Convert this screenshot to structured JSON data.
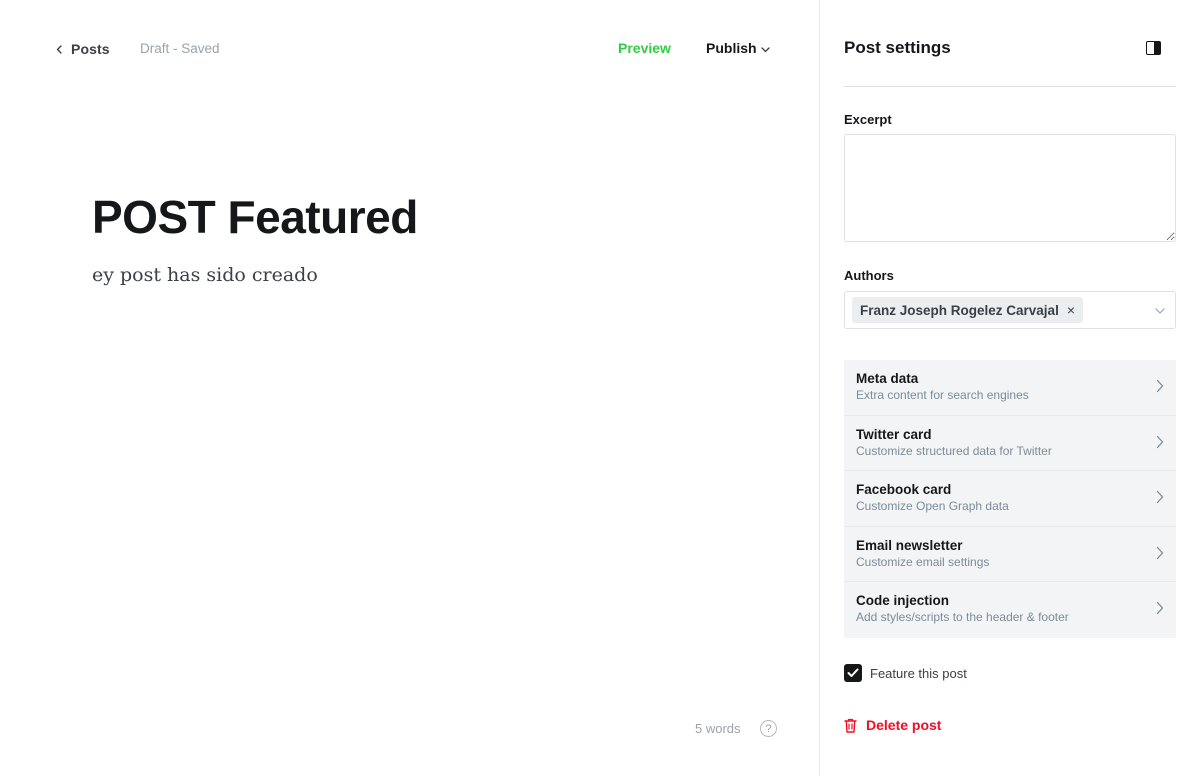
{
  "header": {
    "back_label": "Posts",
    "status": "Draft - Saved",
    "preview_label": "Preview",
    "publish_label": "Publish"
  },
  "post": {
    "title": "POST Featured",
    "body": "ey post has sido creado",
    "word_count": "5 words",
    "help_glyph": "?"
  },
  "sidebar": {
    "title": "Post settings",
    "excerpt_label": "Excerpt",
    "excerpt_value": "",
    "authors_label": "Authors",
    "authors": [
      {
        "name": "Franz Joseph Rogelez Carvajal",
        "remove_glyph": "×"
      }
    ],
    "items": [
      {
        "name": "Meta data",
        "desc": "Extra content for search engines"
      },
      {
        "name": "Twitter card",
        "desc": "Customize structured data for Twitter"
      },
      {
        "name": "Facebook card",
        "desc": "Customize Open Graph data"
      },
      {
        "name": "Email newsletter",
        "desc": "Customize email settings"
      },
      {
        "name": "Code injection",
        "desc": "Add styles/scripts to the header & footer"
      }
    ],
    "feature_label": "Feature this post",
    "feature_checked": true,
    "delete_label": "Delete post"
  },
  "colors": {
    "accent_green": "#30cf43",
    "danger_red": "#f50b23",
    "text_dark": "#15171a",
    "muted": "#99a3ad",
    "panel_bg": "#f3f4f5"
  }
}
